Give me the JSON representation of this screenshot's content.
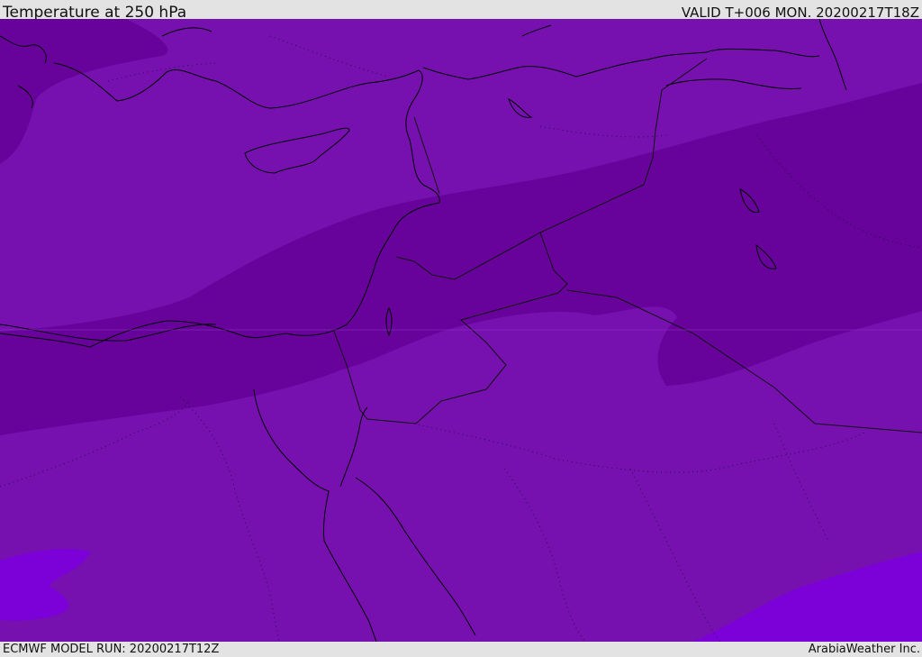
{
  "header": {
    "title": "Temperature at 250 hPa",
    "valid": "VALID T+006 MON. 20200217T18Z"
  },
  "footer": {
    "model_run": "ECMWF MODEL RUN: 20200217T12Z",
    "credit": "ArabiaWeather Inc."
  },
  "colors": {
    "band_mid": "#7611b0",
    "band_cold": "#67039b",
    "band_warm": "#7c00d8",
    "coast": "#000000",
    "border": "#111111",
    "admin": "#2a0a45"
  }
}
